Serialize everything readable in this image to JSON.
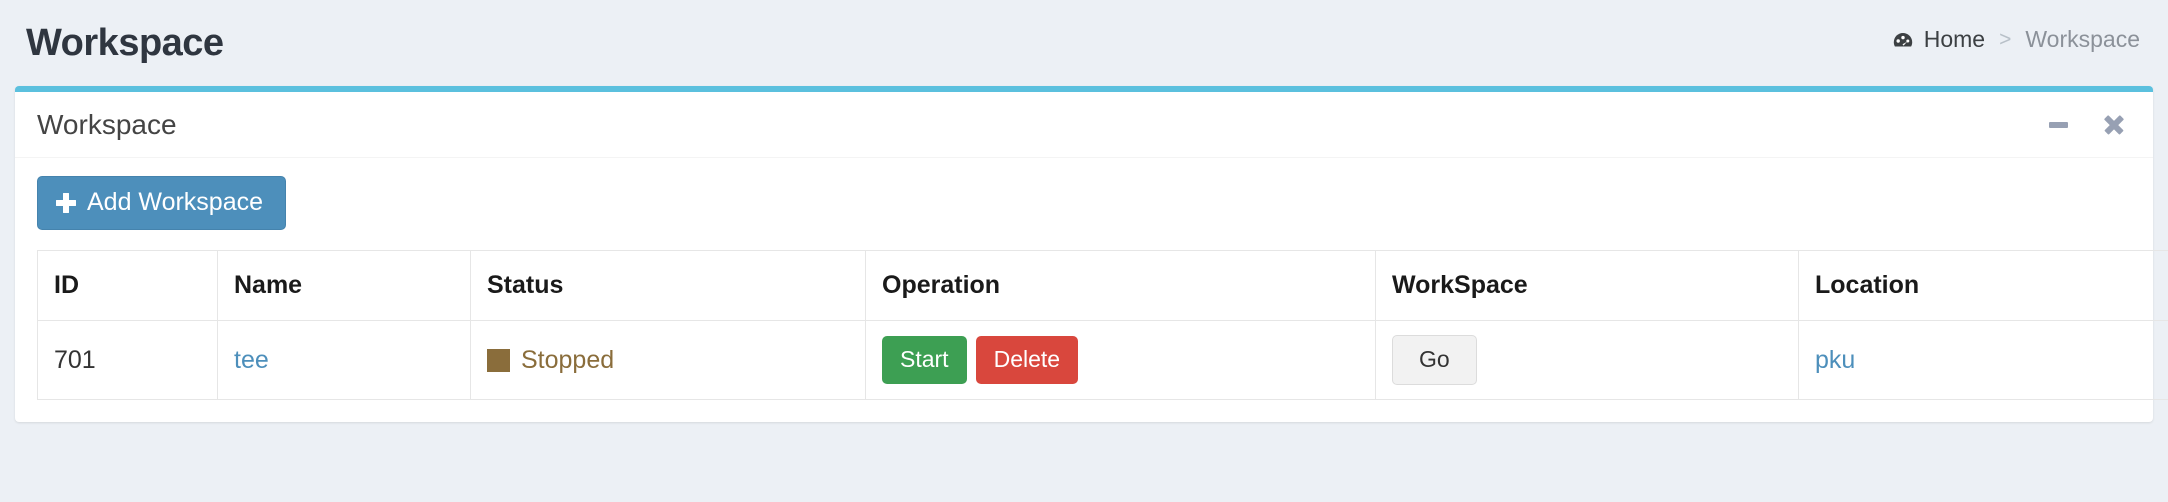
{
  "header": {
    "page_title": "Workspace",
    "breadcrumb": {
      "home_label": "Home",
      "home_icon": "dashboard-icon",
      "separator": ">",
      "active_label": "Workspace"
    }
  },
  "panel": {
    "title": "Workspace",
    "accent_color": "#5bc0de",
    "tools": {
      "minimize_icon": "minus-icon",
      "close_icon": "close-icon"
    }
  },
  "toolbar": {
    "add_label": "Add Workspace",
    "add_icon": "plus-icon",
    "add_color": "#4d8fbb"
  },
  "table": {
    "columns": [
      "ID",
      "Name",
      "Status",
      "Operation",
      "WorkSpace",
      "Location"
    ],
    "rows": [
      {
        "id": "701",
        "name": "tee",
        "status": "Stopped",
        "status_color": "#8a6d3b",
        "operations": [
          {
            "label": "Start",
            "color": "#3d9f53"
          },
          {
            "label": "Delete",
            "color": "#d9473d"
          }
        ],
        "workspace_action": "Go",
        "location": "pku"
      }
    ]
  }
}
